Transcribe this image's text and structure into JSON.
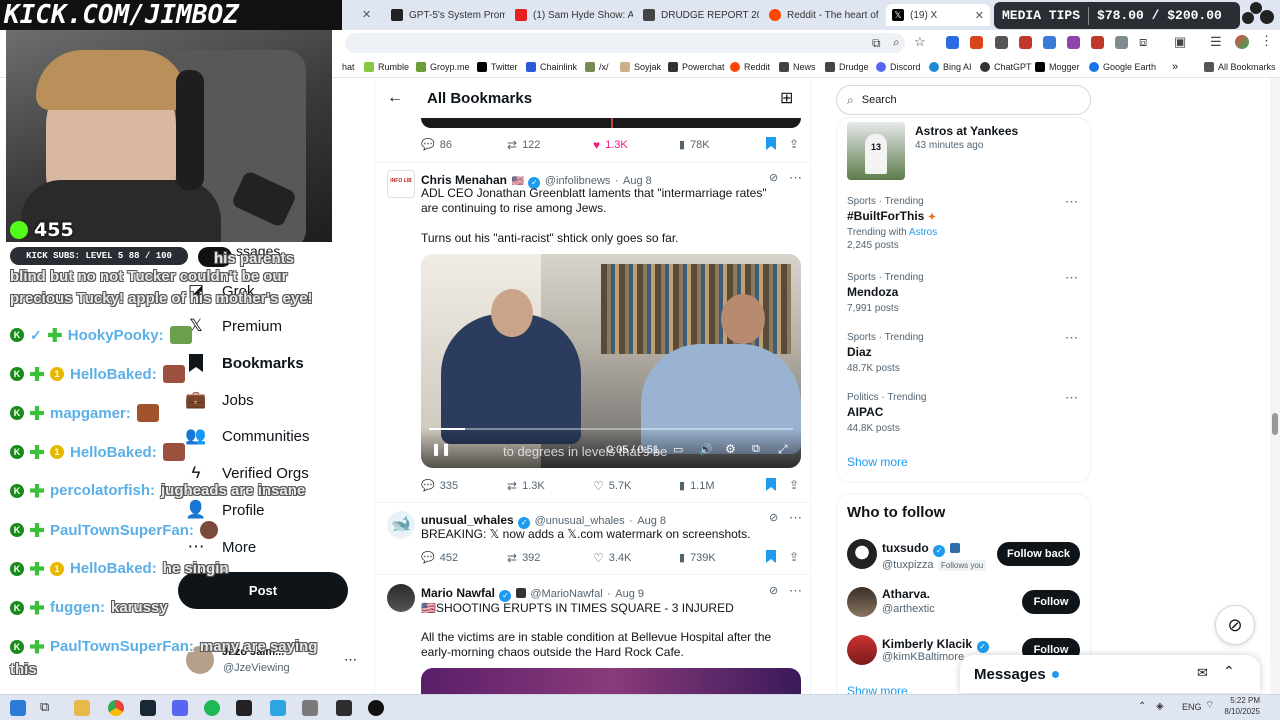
{
  "browser": {
    "tabs": [
      {
        "label": "GPT-5's System Promp",
        "color": "#222"
      },
      {
        "label": "(1) Sam Hyde Show: A",
        "color": "#e52222"
      },
      {
        "label": "DRUDGE REPORT 202",
        "color": "#333"
      },
      {
        "label": "Reddit - The heart of",
        "color": "#ff4500"
      },
      {
        "label": "(19) X",
        "color": "#000"
      }
    ],
    "bookmarks": [
      "hat",
      "Rumble",
      "Groyp.me",
      "Twitter",
      "Chainlink",
      "/x/",
      "Soyjak",
      "Powerchat",
      "Reddit",
      "News",
      "Drudge",
      "Discord",
      "Bing AI",
      "ChatGPT",
      "Mogger",
      "Google Earth"
    ],
    "all_bookmarks": "All Bookmarks"
  },
  "stream": {
    "banner": "KICK.COM/JIMBOZ",
    "viewers": "455",
    "sub_goal": "KICK SUBS: LEVEL 5  88 / 100",
    "media_tips_label": "MEDIA TIPS",
    "media_tips_amount": "$78.00 / $200.00",
    "chat": [
      {
        "text": "blind but no not Tucker couldn't be our",
        "plain": true
      },
      {
        "text": "precious Tucky! apple of his mother's eye!",
        "plain": true
      },
      {
        "user": "HookyPooky:",
        "msg": "",
        "one": false,
        "check": true
      },
      {
        "user": "HelloBaked:",
        "msg": "",
        "one": true
      },
      {
        "user": "mapgamer:",
        "msg": "",
        "one": false
      },
      {
        "user": "HelloBaked:",
        "msg": "",
        "one": true
      },
      {
        "user": "percolatorfish:",
        "msg": "jugheads are insane",
        "one": false
      },
      {
        "user": "PaulTownSuperFan:",
        "msg": "",
        "one": false
      },
      {
        "user": "HelloBaked:",
        "msg": "he singin",
        "one": true
      },
      {
        "user": "fuggen:",
        "msg": "karussy",
        "one": false
      },
      {
        "user": "PaulTownSuperFan:",
        "msg": "many are saying",
        "one": false
      },
      {
        "text": "this",
        "plain": true
      }
    ],
    "overlay_fragments": {
      "messages": "ssages",
      "parents": "his parents"
    }
  },
  "nav": {
    "items": [
      "Grok",
      "Premium",
      "Bookmarks",
      "Jobs",
      "Communities",
      "Verified Orgs",
      "Profile",
      "More"
    ],
    "post": "Post",
    "account_handle": "@JzeViewing",
    "account_name": "Jnzo Jalm..."
  },
  "feed": {
    "title": "All Bookmarks",
    "top_actions": {
      "replies": "86",
      "reposts": "122",
      "likes": "1.3K",
      "views": "78K"
    },
    "tweets": [
      {
        "name": "Chris Menahan",
        "handle": "@infolibnews",
        "date": "Aug 8",
        "text1": "ADL CEO Jonathan Greenblatt laments that \"intermarriage rates\" are continuing to rise among Jews.",
        "text2": "Turns out his \"anti-racist\" shtick only goes so far.",
        "video_time": "0:05 / 0:51",
        "caption": "to degrees in levels that's be",
        "replies": "335",
        "reposts": "1.3K",
        "likes": "5.7K",
        "views": "1.1M"
      },
      {
        "name": "unusual_whales",
        "handle": "@unusual_whales",
        "date": "Aug 8",
        "text1": "BREAKING: 𝕏 now adds a 𝕏.com watermark on screenshots.",
        "replies": "452",
        "reposts": "392",
        "likes": "3.4K",
        "views": "739K"
      },
      {
        "name": "Mario Nawfal",
        "handle": "@MarioNawfal",
        "date": "Aug 9",
        "text1": "🇺🇸SHOOTING ERUPTS IN TIMES SQUARE - 3 INJURED",
        "text2": "All the victims are in stable condition at Bellevue Hospital after the early-morning chaos outside the Hard Rock Cafe."
      }
    ]
  },
  "right": {
    "search_placeholder": "Search",
    "event": {
      "title": "Astros at Yankees",
      "time": "43 minutes ago"
    },
    "trends": [
      {
        "meta": "Sports · Trending",
        "title": "#BuiltForThis",
        "extra_prefix": "Trending with",
        "extra_link": "Astros",
        "posts": "2,245 posts"
      },
      {
        "meta": "Sports · Trending",
        "title": "Mendoza",
        "posts": "7,991 posts"
      },
      {
        "meta": "Sports · Trending",
        "title": "Diaz",
        "posts": "48.7K posts"
      },
      {
        "meta": "Politics · Trending",
        "title": "AIPAC",
        "posts": "44.8K posts"
      }
    ],
    "show_more": "Show more",
    "who_to_follow": "Who to follow",
    "suggestions": [
      {
        "name": "tuxsudo",
        "handle": "@tuxpizza",
        "note": "Follows you",
        "button": "Follow back"
      },
      {
        "name": "Atharva.",
        "handle": "@arthextic",
        "button": "Follow"
      },
      {
        "name": "Kimberly Klacik",
        "handle": "@kimKBaltimore",
        "button": "Follow"
      }
    ],
    "show_more_2": "Show more",
    "messages": "Messages"
  },
  "taskbar": {
    "lang": "ENG",
    "time": "5:22 PM",
    "date": "8/10/2025"
  },
  "colors": {
    "x_blue": "#1d9bf0",
    "like_pink": "#f91880",
    "chat_name": "#5ab0e6"
  }
}
